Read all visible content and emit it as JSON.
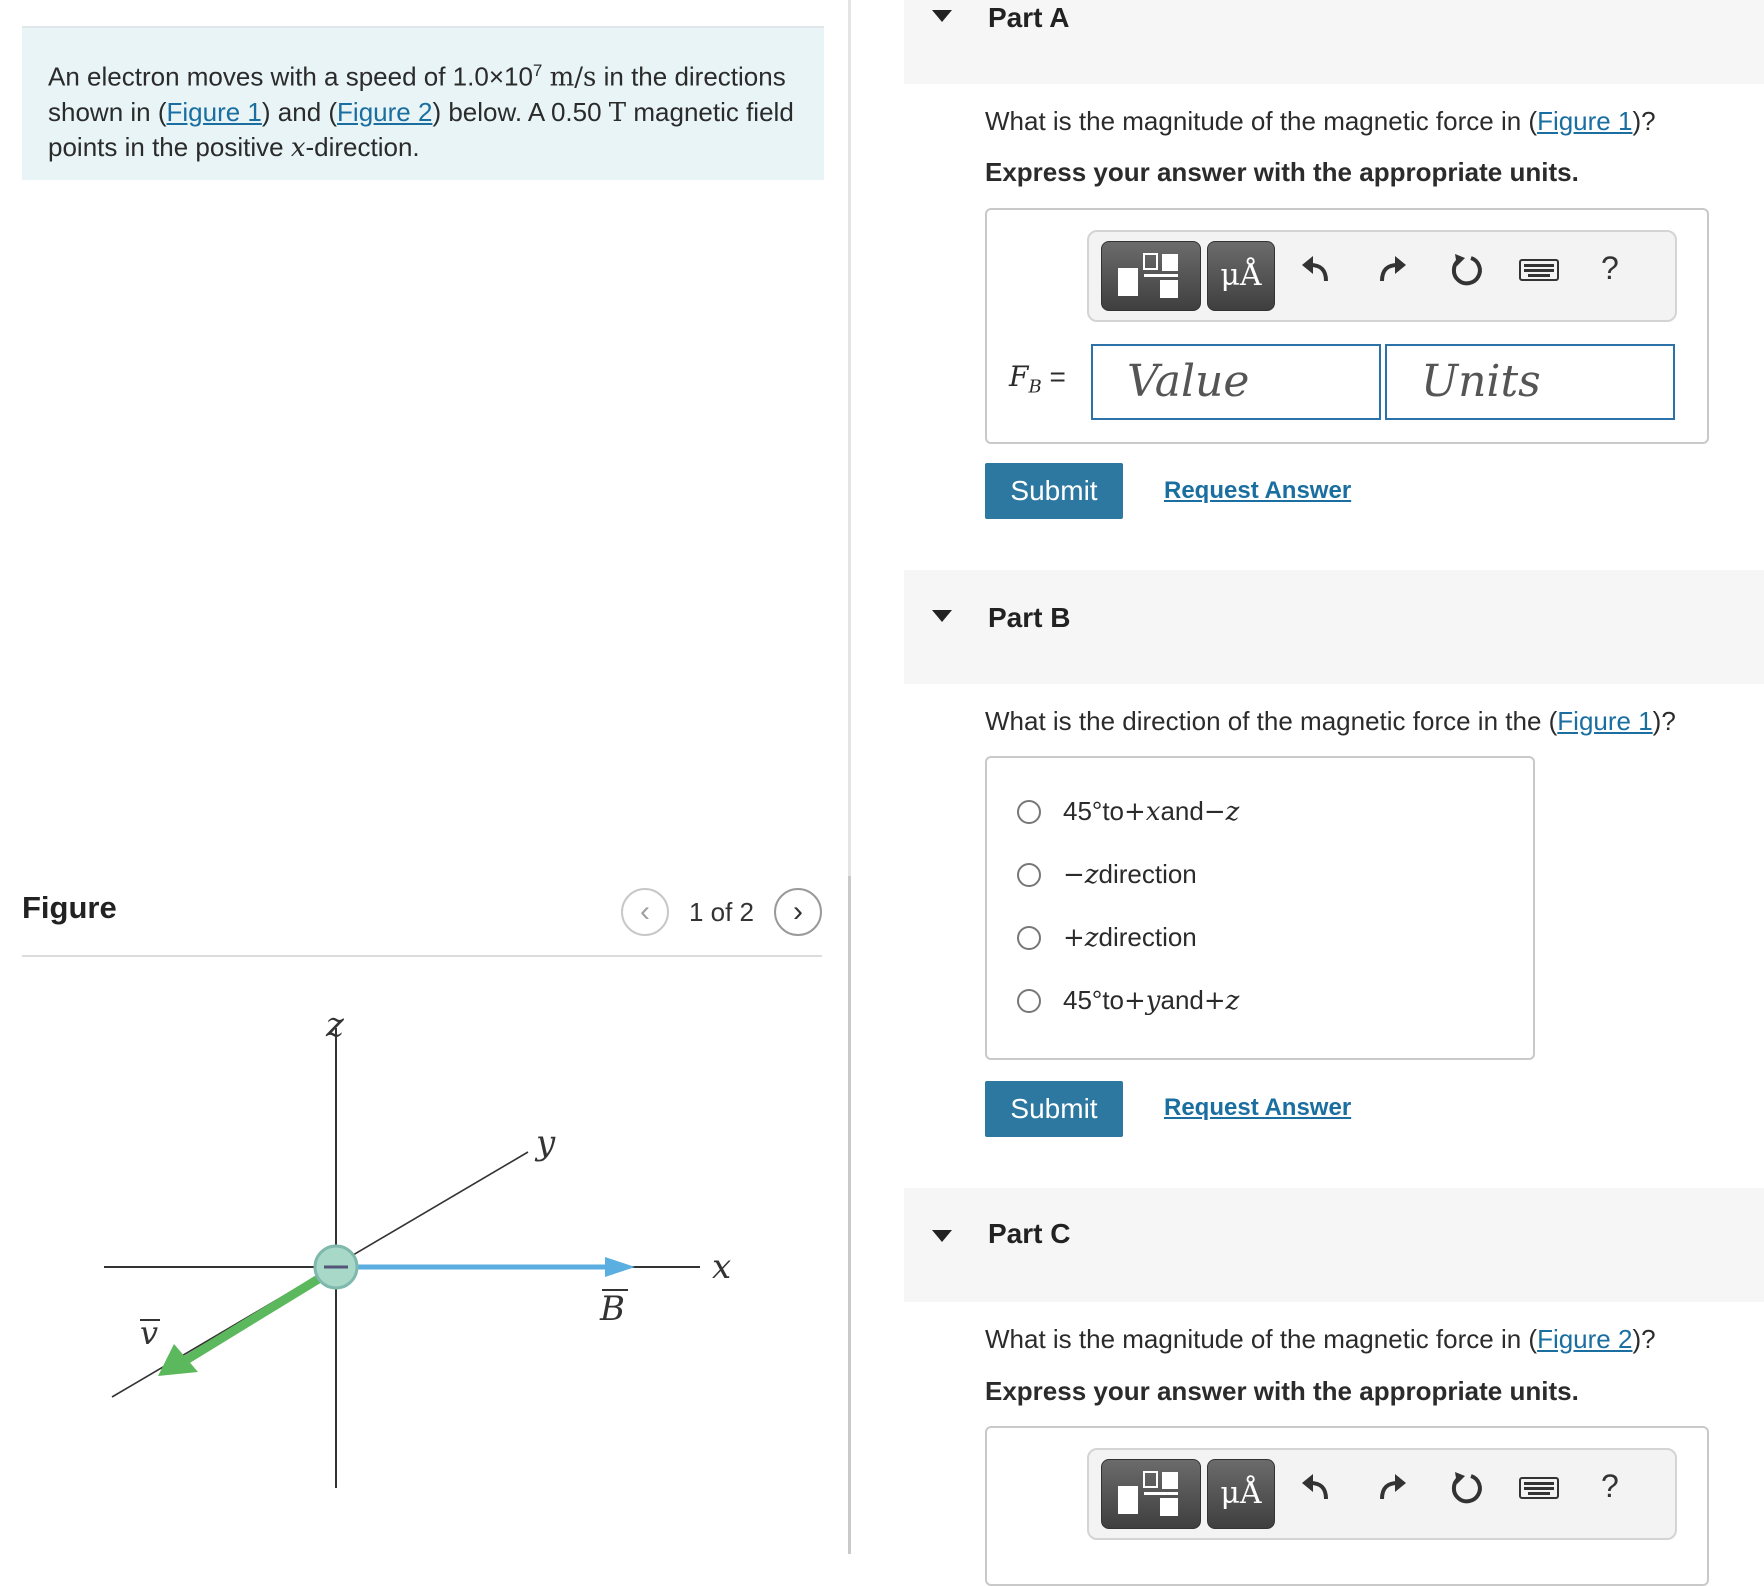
{
  "problem": {
    "t1": "An electron moves with a speed of ",
    "speed": "1.0×10",
    "speed_exp": "7",
    "speed_unit": "m/s",
    "t2": " in the directions shown in (",
    "fig1": "Figure 1",
    "t3": ") and (",
    "fig2": "Figure 2",
    "t4": ") below. A 0.50 ",
    "field_unit": "T",
    "t5": " magnetic field points in the positive ",
    "axis": "x",
    "t6": "-direction."
  },
  "figure": {
    "title": "Figure",
    "counter": "1 of 2",
    "prev": "‹",
    "next": "›",
    "labels": {
      "z": "z",
      "y": "y",
      "x": "x",
      "v": "v",
      "B": "B"
    },
    "colors": {
      "velocity": "#5cb85c",
      "field": "#5aaee0",
      "axes": "#333333"
    }
  },
  "partA": {
    "title": "Part A",
    "q_pre": "What is the magnitude of the magnetic force in (",
    "q_link": "Figure 1",
    "q_post": ")?",
    "instr": "Express your answer with the appropriate units.",
    "var": "F",
    "var_sub": "B",
    "eq": " =",
    "value_placeholder": "Value",
    "units_placeholder": "Units",
    "units_btn": "μÅ",
    "help": "?",
    "submit": "Submit",
    "request": "Request Answer"
  },
  "partB": {
    "title": "Part B",
    "q_pre": "What is the direction of the magnetic force in the (",
    "q_link": "Figure 1",
    "q_post": ")?",
    "options": [
      {
        "a": "45°",
        "b": " to ",
        "c": "+x",
        "d": " and ",
        "e": "−z"
      },
      {
        "a": "",
        "b": "",
        "c": "−z",
        "d": " direction",
        "e": ""
      },
      {
        "a": "",
        "b": "",
        "c": "+z",
        "d": " direction",
        "e": ""
      },
      {
        "a": "45°",
        "b": " to ",
        "c": "+y",
        "d": " and ",
        "e": "+z"
      }
    ],
    "submit": "Submit",
    "request": "Request Answer"
  },
  "partC": {
    "title": "Part C",
    "q_pre": "What is the magnitude of the magnetic force in (",
    "q_link": "Figure 2",
    "q_post": ")?",
    "instr": "Express your answer with the appropriate units.",
    "units_btn": "μÅ",
    "help": "?"
  }
}
